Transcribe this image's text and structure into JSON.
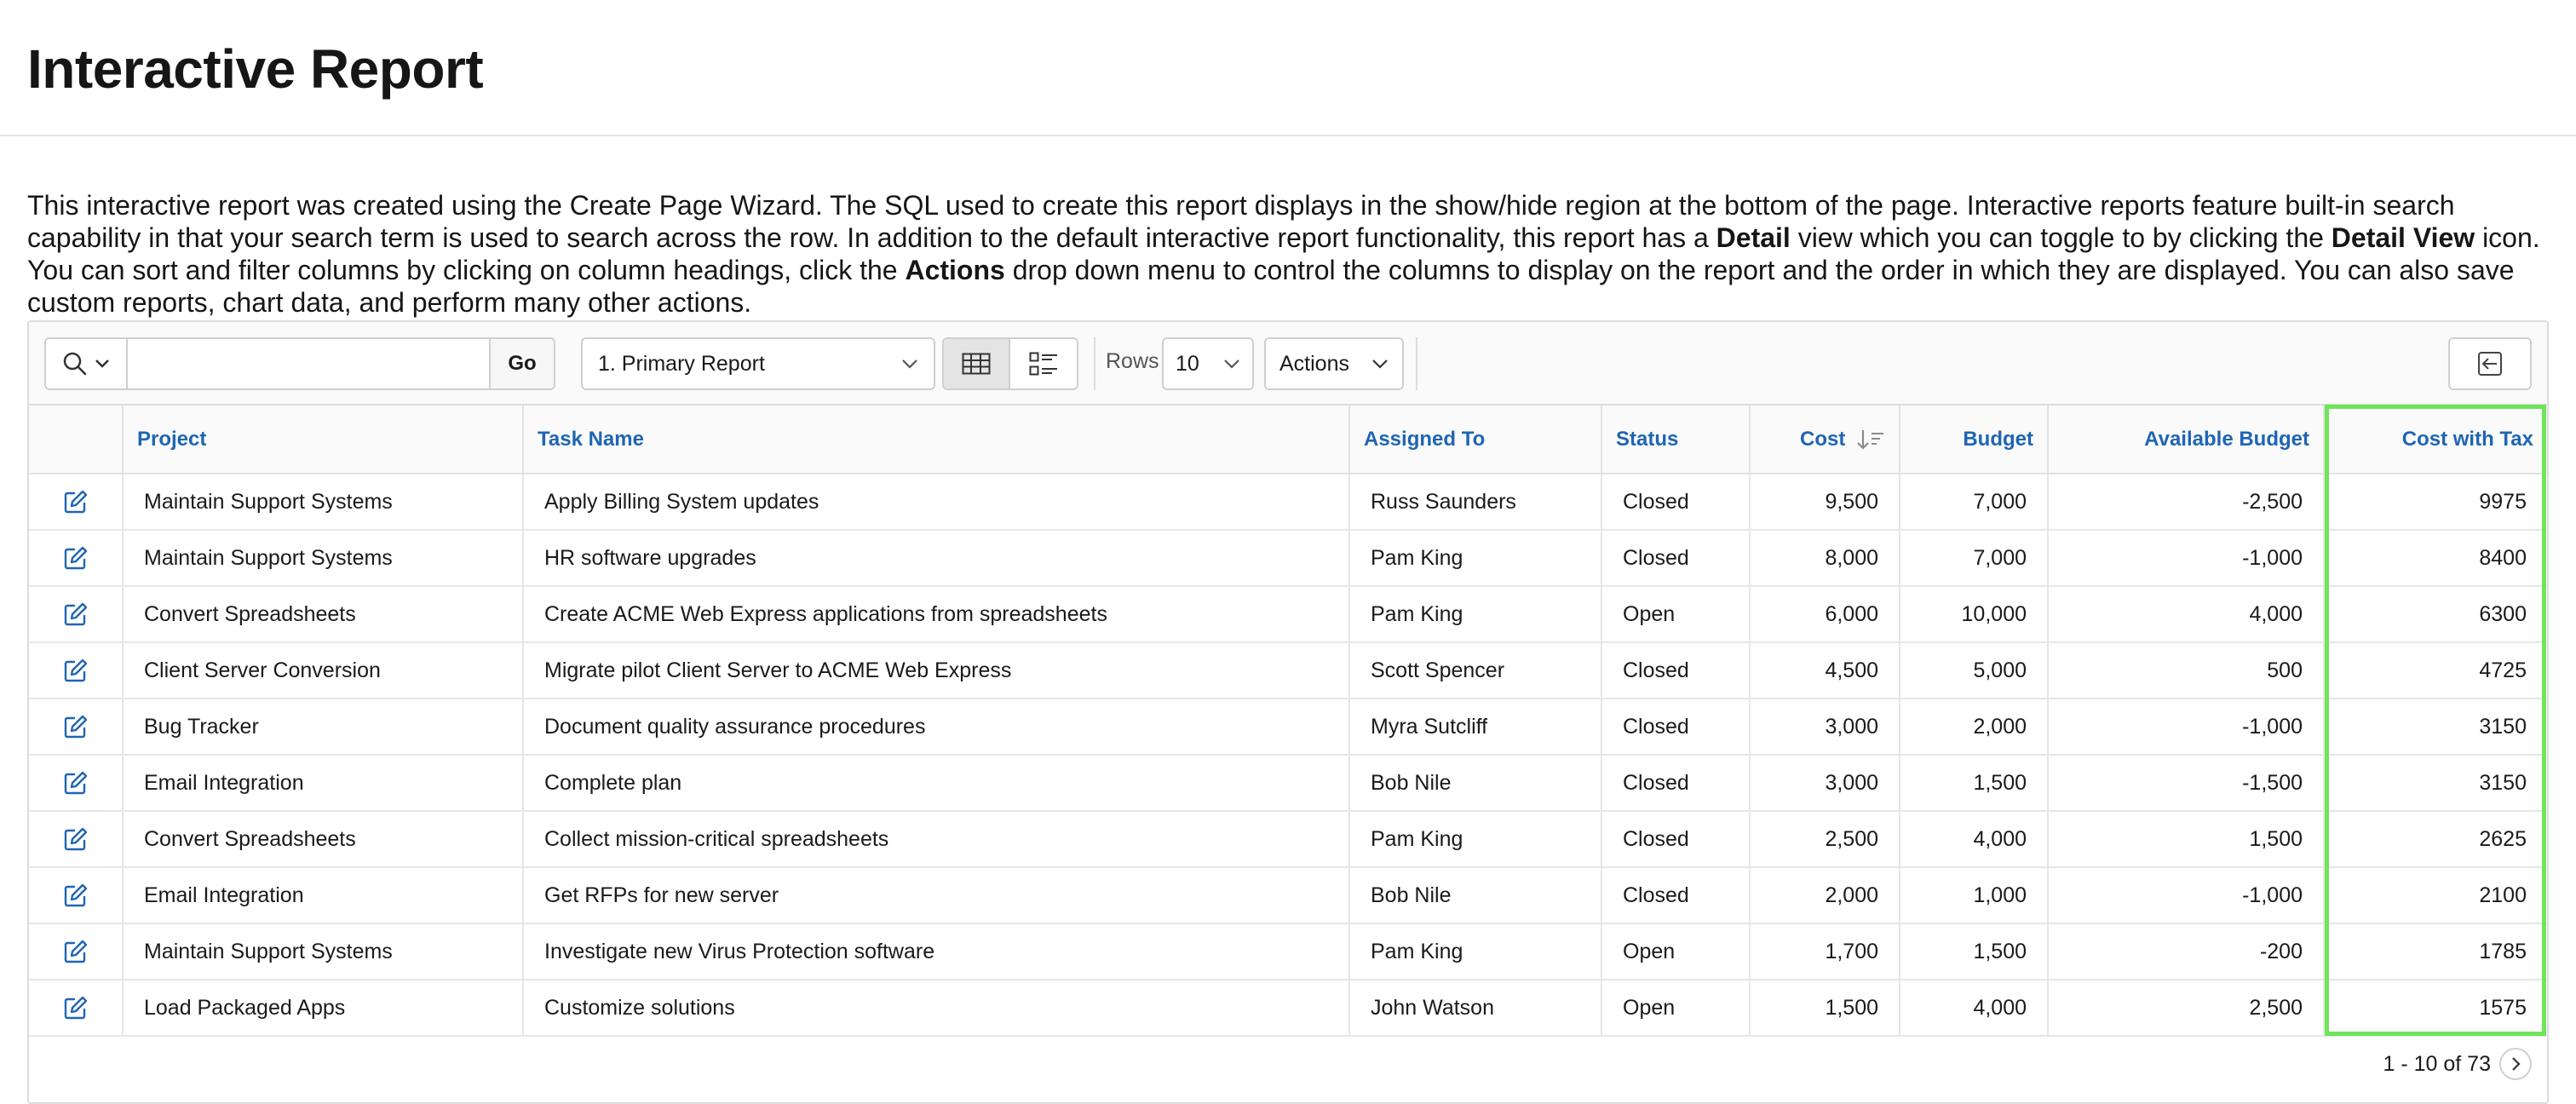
{
  "page": {
    "title": "Interactive Report",
    "intro": [
      {
        "t": "This interactive report was created using the Create Page Wizard. The SQL used to create this report displays in the show/hide region at the bottom of the page. Interactive reports feature built-in search capability in that your search term is used to search across the row. In addition to the default interactive report functionality, this report has a ",
        "b": false
      },
      {
        "t": "Detail",
        "b": true
      },
      {
        "t": " view which you can toggle to by clicking the ",
        "b": false
      },
      {
        "t": "Detail View",
        "b": true
      },
      {
        "t": " icon. You can sort and filter columns by clicking on column headings, click the ",
        "b": false
      },
      {
        "t": "Actions",
        "b": true
      },
      {
        "t": " drop down menu to control the columns to display on the report and the order in which they are displayed. You can also save custom reports, chart data, and perform many other actions.",
        "b": false
      }
    ]
  },
  "toolbar": {
    "search_value": "",
    "go_label": "Go",
    "report_selected": "1. Primary Report",
    "rows_label": "Rows",
    "rows_value": "10",
    "actions_label": "Actions"
  },
  "columns": [
    "Project",
    "Task Name",
    "Assigned To",
    "Status",
    "Cost",
    "Budget",
    "Available Budget",
    "Cost with Tax"
  ],
  "sorted_column": "Cost",
  "rows": [
    [
      "Maintain Support Systems",
      "Apply Billing System updates",
      "Russ Saunders",
      "Closed",
      "9,500",
      "7,000",
      "-2,500",
      "9975"
    ],
    [
      "Maintain Support Systems",
      "HR software upgrades",
      "Pam King",
      "Closed",
      "8,000",
      "7,000",
      "-1,000",
      "8400"
    ],
    [
      "Convert Spreadsheets",
      "Create ACME Web Express applications from spreadsheets",
      "Pam King",
      "Open",
      "6,000",
      "10,000",
      "4,000",
      "6300"
    ],
    [
      "Client Server Conversion",
      "Migrate pilot Client Server to ACME Web Express",
      "Scott Spencer",
      "Closed",
      "4,500",
      "5,000",
      "500",
      "4725"
    ],
    [
      "Bug Tracker",
      "Document quality assurance procedures",
      "Myra Sutcliff",
      "Closed",
      "3,000",
      "2,000",
      "-1,000",
      "3150"
    ],
    [
      "Email Integration",
      "Complete plan",
      "Bob Nile",
      "Closed",
      "3,000",
      "1,500",
      "-1,500",
      "3150"
    ],
    [
      "Convert Spreadsheets",
      "Collect mission-critical spreadsheets",
      "Pam King",
      "Closed",
      "2,500",
      "4,000",
      "1,500",
      "2625"
    ],
    [
      "Email Integration",
      "Get RFPs for new server",
      "Bob Nile",
      "Closed",
      "2,000",
      "1,000",
      "-1,000",
      "2100"
    ],
    [
      "Maintain Support Systems",
      "Investigate new Virus Protection software",
      "Pam King",
      "Open",
      "1,700",
      "1,500",
      "-200",
      "1785"
    ],
    [
      "Load Packaged Apps",
      "Customize solutions",
      "John Watson",
      "Open",
      "1,500",
      "4,000",
      "2,500",
      "1575"
    ]
  ],
  "pagination": {
    "text": "1 - 10 of 73"
  },
  "colors": {
    "link": "#1f65b3",
    "highlight": "#6fe55a",
    "edit_icon": "#1f65b3"
  },
  "icons": [
    "search-icon",
    "chevron-down-icon",
    "grid-view-icon",
    "detail-view-icon",
    "sort-desc-icon",
    "edit-icon",
    "reset-icon",
    "chevron-right-icon"
  ]
}
